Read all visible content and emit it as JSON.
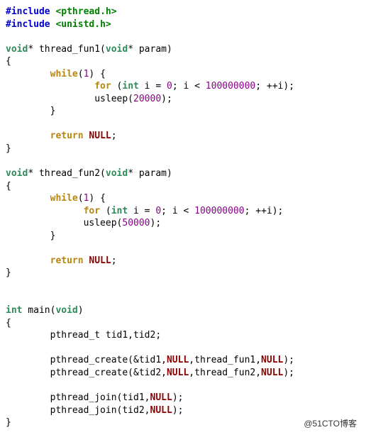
{
  "lines": [
    [
      [
        "kw-include",
        "#include "
      ],
      [
        "hdr",
        "<pthread.h>"
      ]
    ],
    [
      [
        "kw-include",
        "#include "
      ],
      [
        "hdr",
        "<unistd.h>"
      ]
    ],
    [
      [
        "",
        ""
      ]
    ],
    [
      [
        "type",
        "void"
      ],
      [
        "p",
        "* thread_fun1("
      ],
      [
        "type",
        "void"
      ],
      [
        "p",
        "* param)"
      ]
    ],
    [
      [
        "p",
        "{"
      ]
    ],
    [
      [
        "p",
        "        "
      ],
      [
        "kw",
        "while"
      ],
      [
        "p",
        "("
      ],
      [
        "num",
        "1"
      ],
      [
        "p",
        ") {"
      ]
    ],
    [
      [
        "p",
        "                "
      ],
      [
        "kw",
        "for"
      ],
      [
        "p",
        " ("
      ],
      [
        "type",
        "int"
      ],
      [
        "p",
        " i = "
      ],
      [
        "num",
        "0"
      ],
      [
        "p",
        "; i < "
      ],
      [
        "num",
        "100000000"
      ],
      [
        "p",
        "; ++i);"
      ]
    ],
    [
      [
        "p",
        "                usleep("
      ],
      [
        "num",
        "20000"
      ],
      [
        "p",
        ");"
      ]
    ],
    [
      [
        "p",
        "        }"
      ]
    ],
    [
      [
        "",
        ""
      ]
    ],
    [
      [
        "p",
        "        "
      ],
      [
        "kw",
        "return"
      ],
      [
        "p",
        " "
      ],
      [
        "null",
        "NULL"
      ],
      [
        "p",
        ";"
      ]
    ],
    [
      [
        "p",
        "}"
      ]
    ],
    [
      [
        "",
        ""
      ]
    ],
    [
      [
        "type",
        "void"
      ],
      [
        "p",
        "* thread_fun2("
      ],
      [
        "type",
        "void"
      ],
      [
        "p",
        "* param)"
      ]
    ],
    [
      [
        "p",
        "{"
      ]
    ],
    [
      [
        "p",
        "        "
      ],
      [
        "kw",
        "while"
      ],
      [
        "p",
        "("
      ],
      [
        "num",
        "1"
      ],
      [
        "p",
        ") {"
      ]
    ],
    [
      [
        "p",
        "              "
      ],
      [
        "kw",
        "for"
      ],
      [
        "p",
        " ("
      ],
      [
        "type",
        "int"
      ],
      [
        "p",
        " i = "
      ],
      [
        "num",
        "0"
      ],
      [
        "p",
        "; i < "
      ],
      [
        "num",
        "100000000"
      ],
      [
        "p",
        "; ++i);"
      ]
    ],
    [
      [
        "p",
        "              usleep("
      ],
      [
        "num",
        "50000"
      ],
      [
        "p",
        ");"
      ]
    ],
    [
      [
        "p",
        "        }"
      ]
    ],
    [
      [
        "",
        ""
      ]
    ],
    [
      [
        "p",
        "        "
      ],
      [
        "kw",
        "return"
      ],
      [
        "p",
        " "
      ],
      [
        "null",
        "NULL"
      ],
      [
        "p",
        ";"
      ]
    ],
    [
      [
        "p",
        "}"
      ]
    ],
    [
      [
        "",
        ""
      ]
    ],
    [
      [
        "",
        ""
      ]
    ],
    [
      [
        "type",
        "int"
      ],
      [
        "p",
        " main("
      ],
      [
        "type",
        "void"
      ],
      [
        "p",
        ")"
      ]
    ],
    [
      [
        "p",
        "{"
      ]
    ],
    [
      [
        "p",
        "        pthread_t tid1,tid2;"
      ]
    ],
    [
      [
        "",
        ""
      ]
    ],
    [
      [
        "p",
        "        pthread_create(&tid1,"
      ],
      [
        "null",
        "NULL"
      ],
      [
        "p",
        ",thread_fun1,"
      ],
      [
        "null",
        "NULL"
      ],
      [
        "p",
        ");"
      ]
    ],
    [
      [
        "p",
        "        pthread_create(&tid2,"
      ],
      [
        "null",
        "NULL"
      ],
      [
        "p",
        ",thread_fun2,"
      ],
      [
        "null",
        "NULL"
      ],
      [
        "p",
        ");"
      ]
    ],
    [
      [
        "",
        ""
      ]
    ],
    [
      [
        "p",
        "        pthread_join(tid1,"
      ],
      [
        "null",
        "NULL"
      ],
      [
        "p",
        ");"
      ]
    ],
    [
      [
        "p",
        "        pthread_join(tid2,"
      ],
      [
        "null",
        "NULL"
      ],
      [
        "p",
        ");"
      ]
    ],
    [
      [
        "p",
        "}"
      ]
    ]
  ],
  "watermark": "@51CTO博客"
}
